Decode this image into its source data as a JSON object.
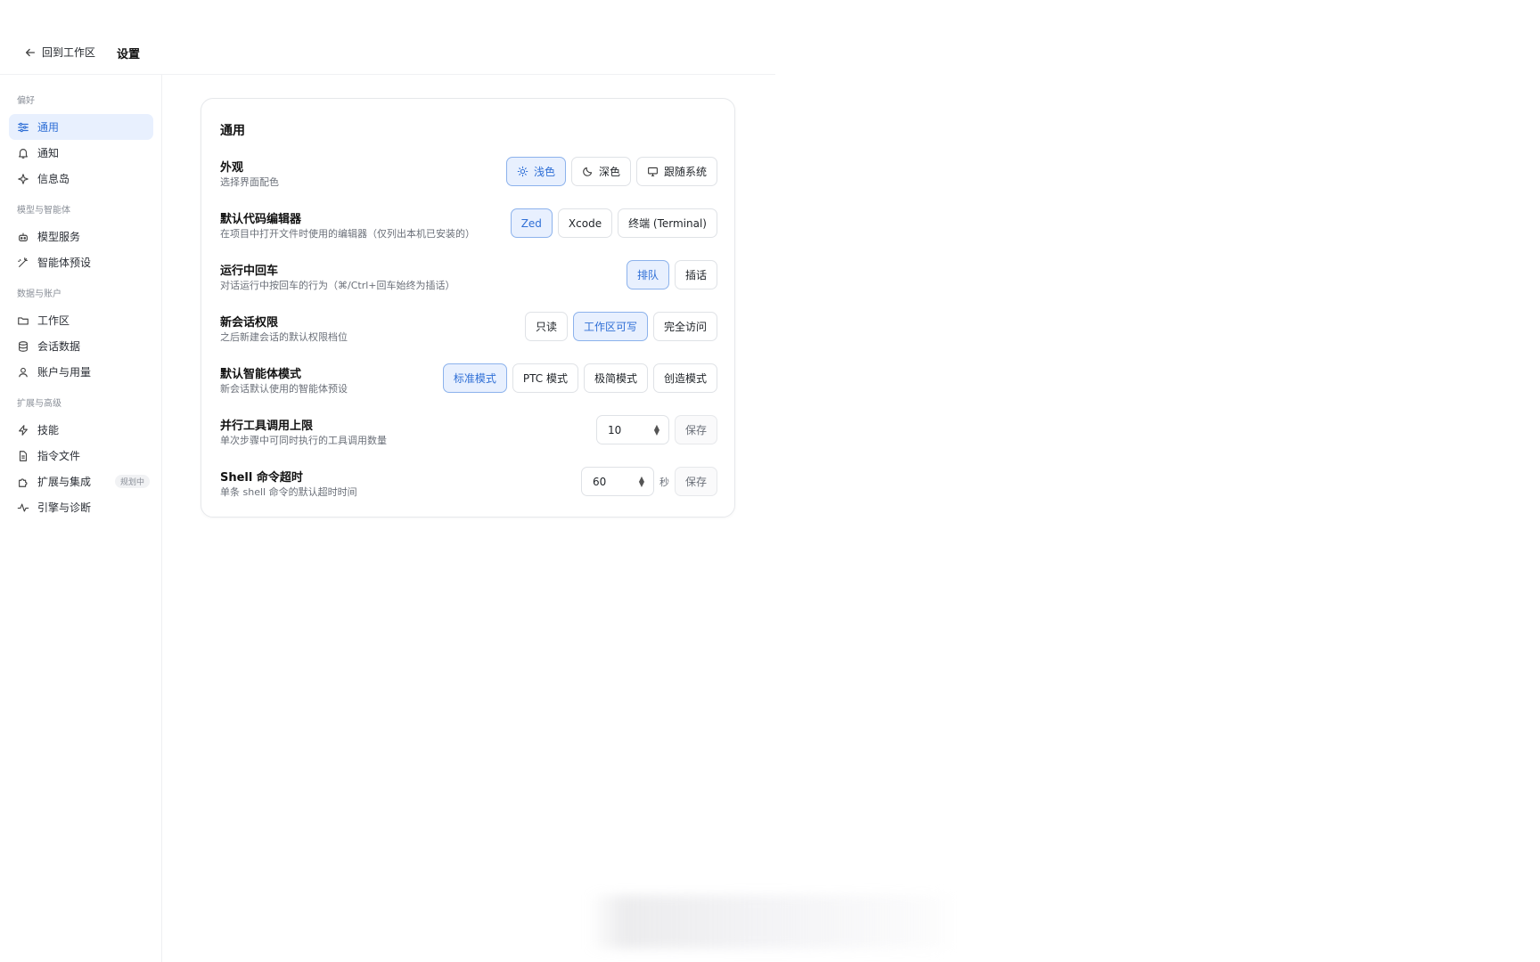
{
  "header": {
    "back_label": "回到工作区",
    "title": "设置"
  },
  "sidebar": {
    "groups": [
      {
        "title": "偏好",
        "items": [
          {
            "label": "通用",
            "icon": "sliders-icon",
            "active": true
          },
          {
            "label": "通知",
            "icon": "bell-icon"
          },
          {
            "label": "信息岛",
            "icon": "sparkle-icon"
          }
        ]
      },
      {
        "title": "模型与智能体",
        "items": [
          {
            "label": "模型服务",
            "icon": "bot-icon"
          },
          {
            "label": "智能体预设",
            "icon": "wand-icon"
          }
        ]
      },
      {
        "title": "数据与账户",
        "items": [
          {
            "label": "工作区",
            "icon": "folder-icon"
          },
          {
            "label": "会话数据",
            "icon": "database-icon"
          },
          {
            "label": "账户与用量",
            "icon": "user-icon"
          }
        ]
      },
      {
        "title": "扩展与高级",
        "items": [
          {
            "label": "技能",
            "icon": "bolt-icon"
          },
          {
            "label": "指令文件",
            "icon": "file-icon"
          },
          {
            "label": "扩展与集成",
            "icon": "puzzle-icon",
            "badge": "规划中"
          },
          {
            "label": "引擎与诊断",
            "icon": "activity-icon"
          }
        ]
      }
    ]
  },
  "card": {
    "title": "通用",
    "rows": [
      {
        "label": "外观",
        "desc": "选择界面配色",
        "options": [
          "浅色",
          "深色",
          "跟随系统"
        ],
        "selected": "浅色"
      },
      {
        "label": "默认代码编辑器",
        "desc": "在项目中打开文件时使用的编辑器（仅列出本机已安装的）",
        "options": [
          "Zed",
          "Xcode",
          "终端 (Terminal)"
        ],
        "selected": "Zed"
      },
      {
        "label": "运行中回车",
        "desc": "对话运行中按回车的行为（⌘/Ctrl+回车始终为插话）",
        "options": [
          "排队",
          "插话"
        ],
        "selected": "排队"
      },
      {
        "label": "新会话权限",
        "desc": "之后新建会话的默认权限档位",
        "options": [
          "只读",
          "工作区可写",
          "完全访问"
        ],
        "selected": "工作区可写"
      },
      {
        "label": "默认智能体模式",
        "desc": "新会话默认使用的智能体预设",
        "options": [
          "标准模式",
          "PTC 模式",
          "极简模式",
          "创造模式"
        ],
        "selected": "标准模式"
      },
      {
        "label": "并行工具调用上限",
        "desc": "单次步骤中可同时执行的工具调用数量",
        "value": "10",
        "save_label": "保存"
      },
      {
        "label": "Shell 命令超时",
        "desc": "单条 shell 命令的默认超时时间",
        "value": "60",
        "unit": "秒",
        "save_label": "保存"
      }
    ]
  },
  "colors": {
    "accent": "#2f6fd6",
    "accent_bg": "#e8f0fe"
  }
}
